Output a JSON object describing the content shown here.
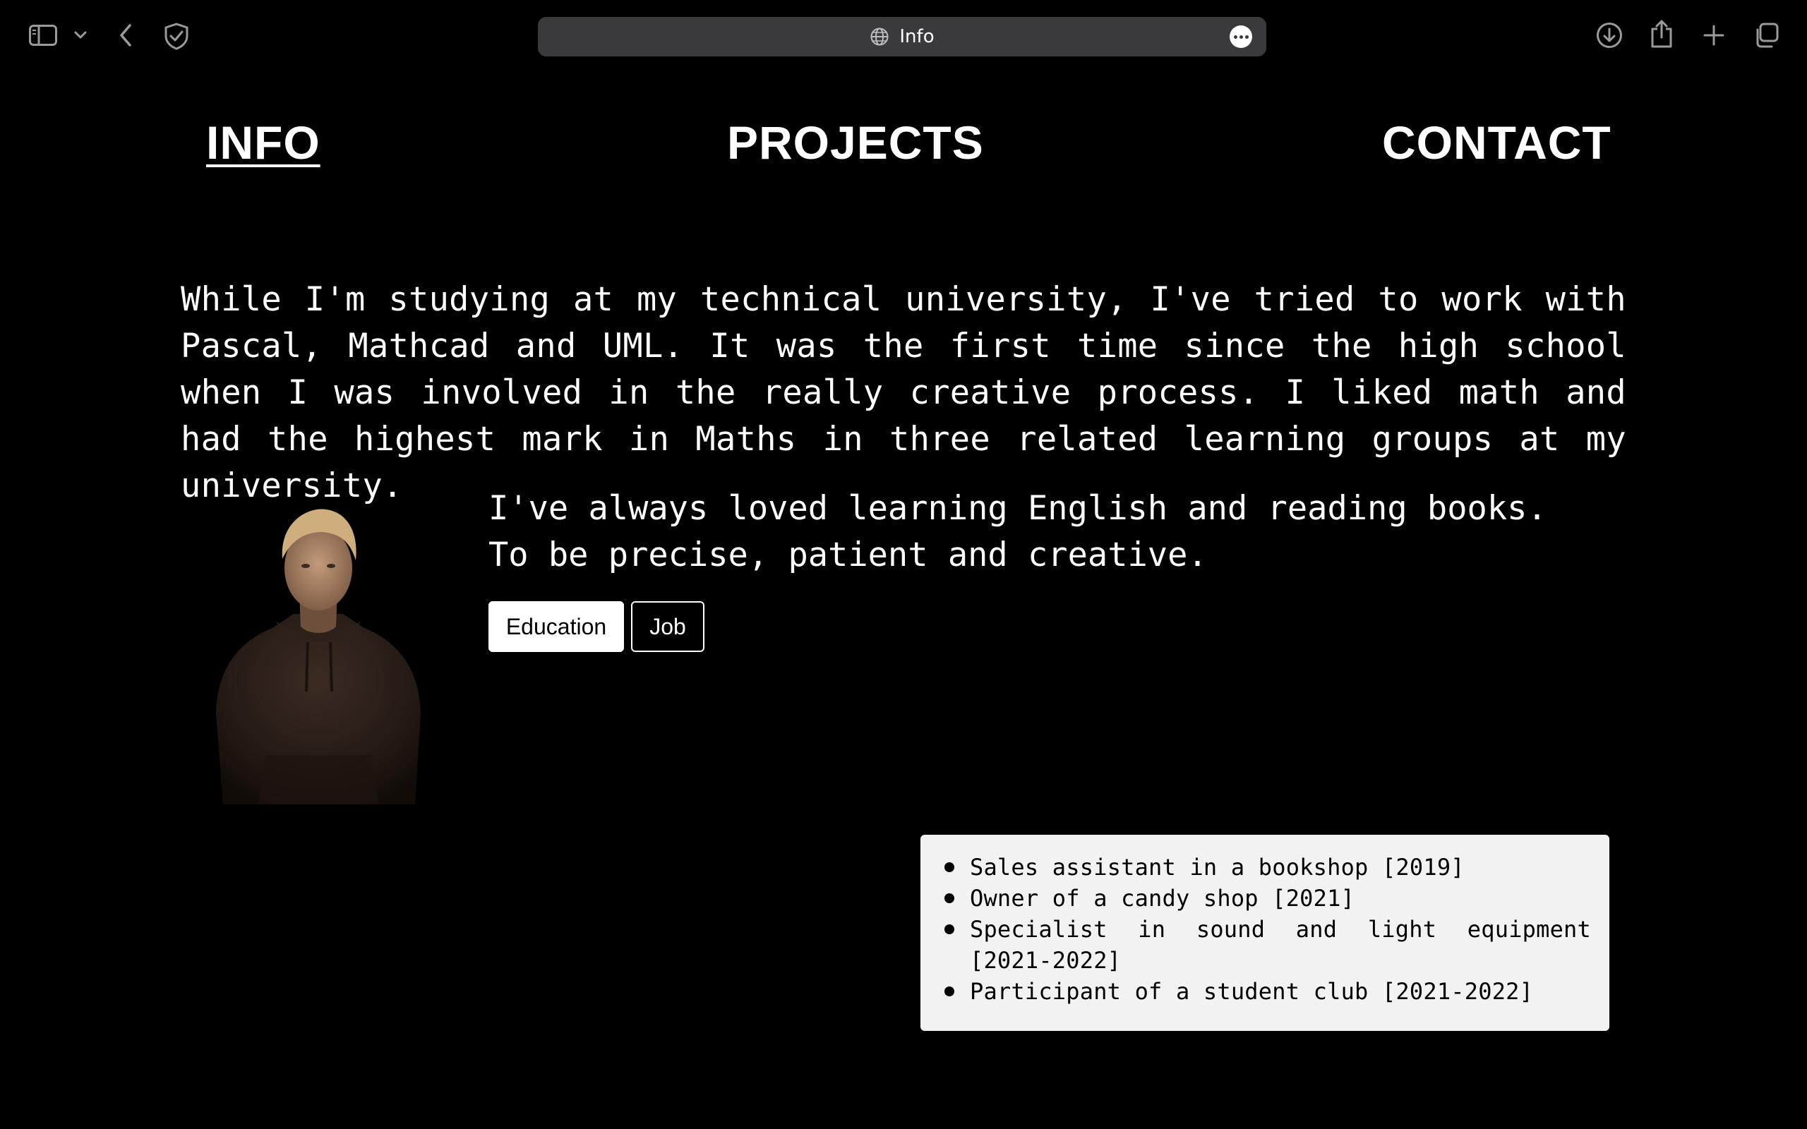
{
  "browser": {
    "tab_title": "Info",
    "icons": {
      "sidebar": "sidebar-icon",
      "chevron": "chevron-down-icon",
      "back": "back-icon",
      "shield": "shield-icon",
      "globe": "globe-icon",
      "more": "more-icon",
      "download": "download-icon",
      "share": "share-icon",
      "new_tab": "plus-icon",
      "tabs": "tabs-overview-icon"
    }
  },
  "nav": {
    "info": "INFO",
    "projects": "PROJECTS",
    "contact": "CONTACT",
    "active": "info"
  },
  "intro_text": "While I'm studying at my technical university, I've tried to work with Pascal, Mathcad and UML. It was the first time since the high school when I was involved in the really creative process. I liked math and had the highest mark in Maths in three related learning groups at my university.",
  "tagline": {
    "line1": "I've always loved learning English and reading books.",
    "line2": "To be precise, patient and creative."
  },
  "buttons": {
    "education": "Education",
    "job": "Job"
  },
  "jobs": [
    "Sales assistant in a bookshop [2019]",
    "Owner of a candy shop [2021]",
    "Specialist in sound and light equipment [2021-2022]",
    "Participant of a student club [2021-2022]"
  ],
  "colors": {
    "background": "#000000",
    "text": "#ffffff",
    "url_bar": "#3a3a3c",
    "card": "#f2f2f2"
  }
}
